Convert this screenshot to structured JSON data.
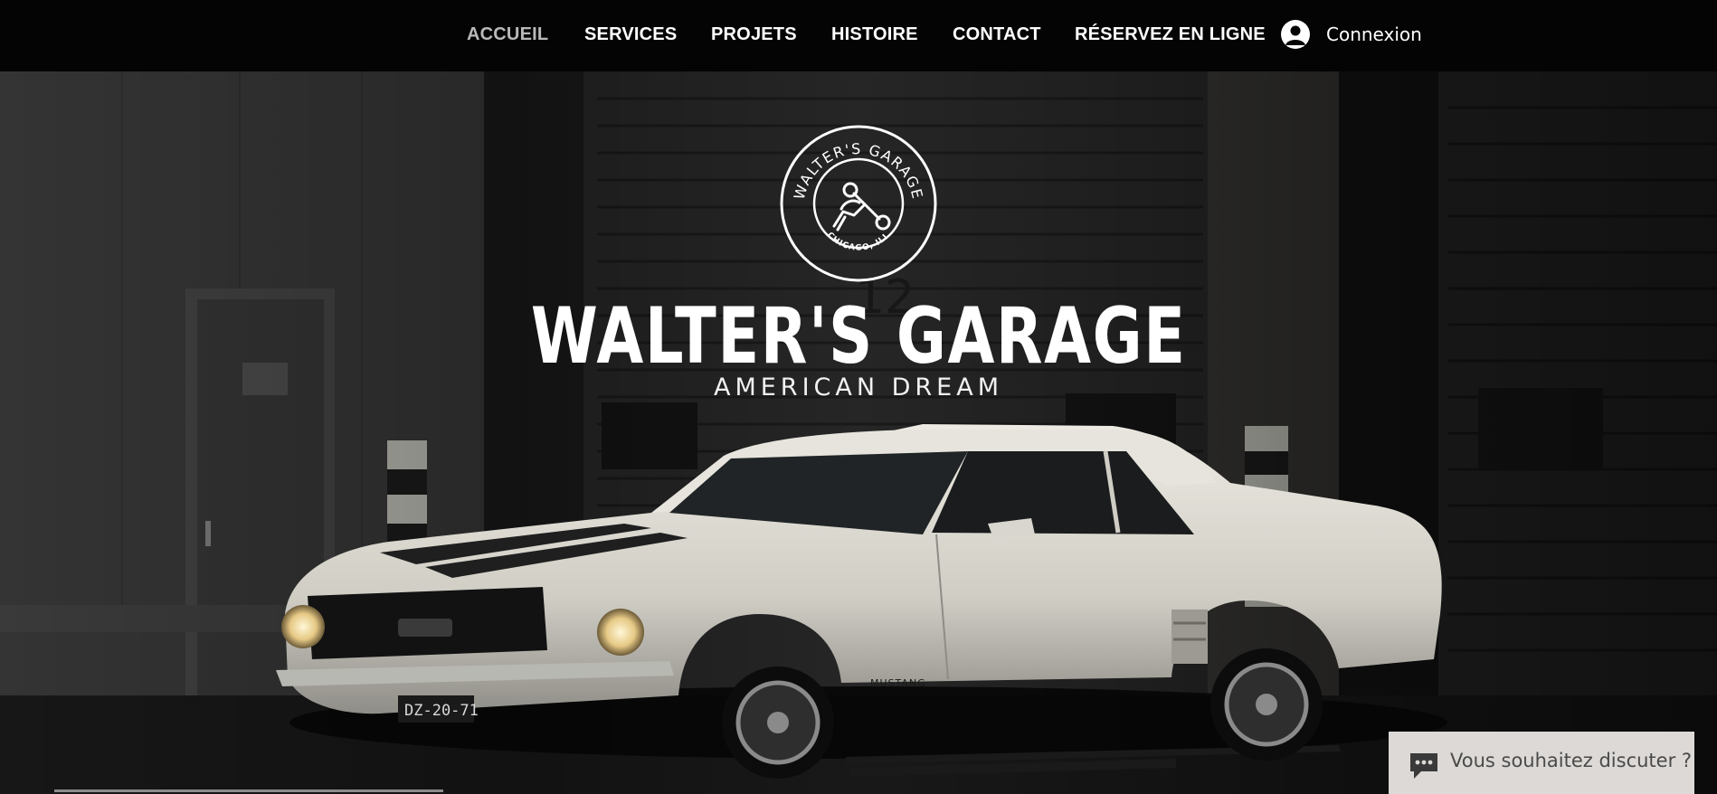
{
  "nav": {
    "items": [
      {
        "label": "ACCUEIL",
        "active": true
      },
      {
        "label": "SERVICES",
        "active": false
      },
      {
        "label": "PROJETS",
        "active": false
      },
      {
        "label": "HISTOIRE",
        "active": false
      },
      {
        "label": "CONTACT",
        "active": false
      },
      {
        "label": "RÉSERVEZ EN LIGNE",
        "active": false
      }
    ],
    "login_label": "Connexion",
    "login_icon": "user-avatar-icon"
  },
  "hero": {
    "logo": {
      "ring_text": "WALTER'S GARAGE",
      "bottom_text": "CHICAGO, ILL",
      "icon": "wrench-hand-icon"
    },
    "title": "WALTER'S GARAGE",
    "subtitle": "AMERICAN DREAM",
    "car_plate": "DZ-20-71",
    "car_badge": "MUSTANG",
    "door_number": "12"
  },
  "chat": {
    "label": "Vous souhaitez discuter ?",
    "icon": "chat-bubble-icon"
  },
  "colors": {
    "header_bg": "#040404",
    "nav_active": "#b9b9b9",
    "nav_text": "#ffffff",
    "chat_bg": "#dcd9d6",
    "chat_text": "#4a4a4a"
  }
}
